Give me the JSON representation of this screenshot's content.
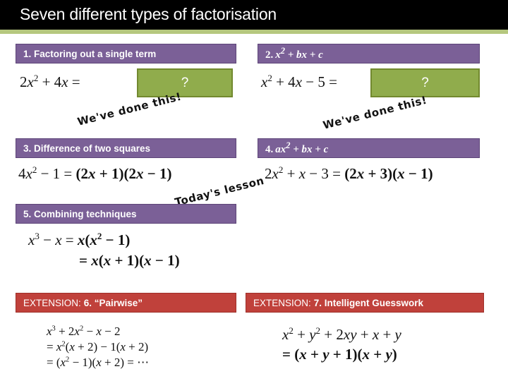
{
  "slide": {
    "title": "Seven different types of factorisation",
    "title_bg": "#000000",
    "accent_color": "#b5c77e",
    "purple": "#7b6097",
    "red": "#c0413b",
    "green": "#90ac4c"
  },
  "sections": [
    {
      "id": "s1",
      "number": "1.",
      "header_plain": "1. Factoring out a single term",
      "equation_lhs_html": "2<i>x</i><sup>2</sup> + 4<i>x</i> =",
      "answer_placeholder": "?",
      "annotation": "We've done this!"
    },
    {
      "id": "s2",
      "number": "2.",
      "header_math_html": "<span class=\"num-hdr\">2.</span><span class=\"math-hdr\">x<sup>2</sup> + bx + c</span>",
      "equation_lhs_html": "<i>x</i><sup>2</sup> + 4<i>x</i> &#8722; 5 =",
      "answer_placeholder": "?",
      "annotation": "We've done this!"
    },
    {
      "id": "s3",
      "number": "3.",
      "header_plain": "3. Difference of two squares",
      "equation_html": "4<i>x</i><sup>2</sup> &#8722; 1 = <b>(2<i>x</i> + 1)(2<i>x</i> &#8722; 1)</b>",
      "annotation": "Today's lesson"
    },
    {
      "id": "s4",
      "number": "4.",
      "header_math_html": "<span class=\"num-hdr\">4.</span><span class=\"math-hdr\">ax<sup>2</sup> + bx + c</span>",
      "equation_html": "2<i>x</i><sup>2</sup> + <i>x</i> &#8722; 3 = <b>(2<i>x</i> + 3)(<i>x</i> &#8722; 1)</b>"
    },
    {
      "id": "s5",
      "number": "5.",
      "header_plain": "5. Combining techniques",
      "equation_line1_html": "<i>x</i><sup>3</sup> &#8722; <i>x</i> = <b><i>x</i>(<i>x</i><sup>2</sup> &#8722; 1)</b>",
      "equation_line2_html": "<b>= <i>x</i>(<i>x</i> + 1)(<i>x</i> &#8722; 1)</b>"
    },
    {
      "id": "s6",
      "number": "6.",
      "header_prefix": "EXTENSION:",
      "header_main": "6. “Pairwise”",
      "equation_line1_html": "<i>x</i><sup>3</sup> + 2<i>x</i><sup>2</sup> &#8722; <i>x</i> &#8722; 2",
      "equation_line2_html": "= <i>x</i><sup>2</sup>(<i>x</i> + 2) &#8722; 1(<i>x</i> + 2)",
      "equation_line3_html": "= (<i>x</i><sup>2</sup> &#8722; 1)(<i>x</i> + 2) = &#8943;"
    },
    {
      "id": "s7",
      "number": "7.",
      "header_prefix": "EXTENSION:",
      "header_main": "7. Intelligent Guesswork",
      "equation_line1_html": "<i>x</i><sup>2</sup> + <i>y</i><sup>2</sup> + 2<i>xy</i> + <i>x</i> + <i>y</i>",
      "equation_line2_html": "<b>= (<i>x</i> + <i>y</i> + 1)(<i>x</i> + <i>y</i>)</b>"
    }
  ]
}
